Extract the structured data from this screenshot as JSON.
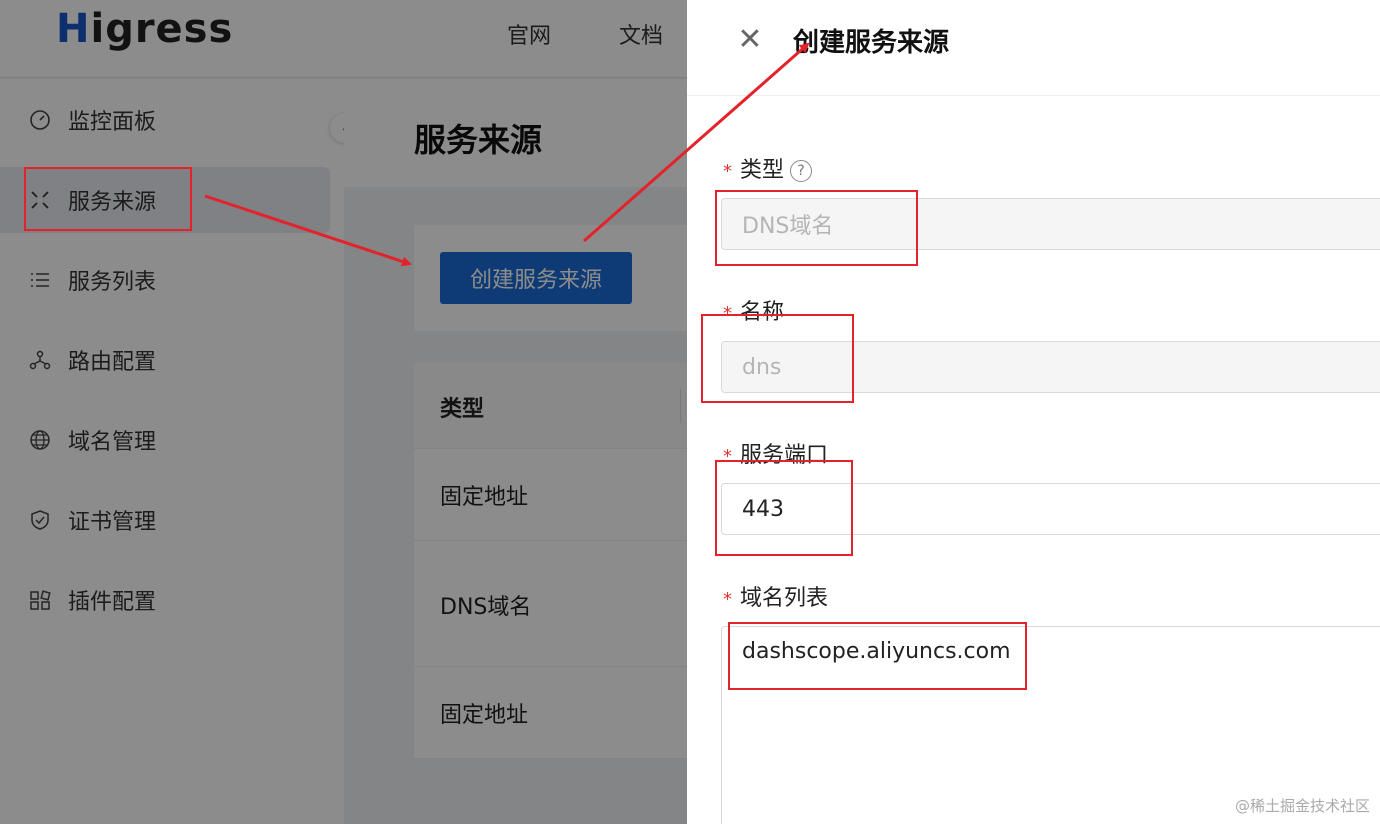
{
  "app": {
    "logo_text": "igress",
    "logo_initial": "H",
    "top_links": [
      "官网",
      "文档"
    ]
  },
  "sidebar": {
    "items": [
      {
        "label": "监控面板",
        "icon": "dashboard-icon"
      },
      {
        "label": "服务来源",
        "icon": "service-source-icon"
      },
      {
        "label": "服务列表",
        "icon": "list-icon"
      },
      {
        "label": "路由配置",
        "icon": "route-icon"
      },
      {
        "label": "域名管理",
        "icon": "globe-icon"
      },
      {
        "label": "证书管理",
        "icon": "shield-check-icon"
      },
      {
        "label": "插件配置",
        "icon": "plugin-icon"
      }
    ],
    "active_index": 1
  },
  "page": {
    "title": "服务来源",
    "create_button": "创建服务来源",
    "table": {
      "header": "类型",
      "rows": [
        "固定地址",
        "DNS域名",
        "固定地址"
      ]
    }
  },
  "drawer": {
    "title": "创建服务来源",
    "fields": {
      "type": {
        "label": "类型",
        "value": "DNS域名"
      },
      "name": {
        "label": "名称",
        "value": "dns"
      },
      "port": {
        "label": "服务端口",
        "value": "443"
      },
      "domains": {
        "label": "域名列表",
        "value": "dashscope.aliyuncs.com"
      }
    },
    "required_mark": "*",
    "help_glyph": "?"
  },
  "watermark": "@稀土掘金技术社区",
  "colors": {
    "primary": "#1a6cd6",
    "annotation": "#e3222a",
    "logo_accent": "#1a56c8"
  }
}
